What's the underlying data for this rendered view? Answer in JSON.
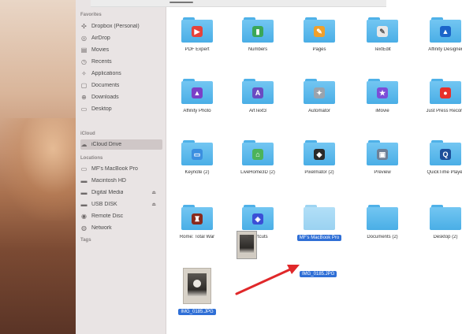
{
  "sidebar": {
    "sections": {
      "favorites": "Favorites",
      "cloud": "iCloud",
      "locations": "Locations",
      "tags": "Tags"
    },
    "favorites": [
      {
        "label": "Dropbox (Personal)",
        "icon": "dropbox-icon"
      },
      {
        "label": "AirDrop",
        "icon": "airdrop-icon"
      },
      {
        "label": "Movies",
        "icon": "movies-icon"
      },
      {
        "label": "Recents",
        "icon": "recents-icon"
      },
      {
        "label": "Applications",
        "icon": "applications-icon"
      },
      {
        "label": "Documents",
        "icon": "documents-icon"
      },
      {
        "label": "Downloads",
        "icon": "downloads-icon"
      },
      {
        "label": "Desktop",
        "icon": "desktop-icon"
      }
    ],
    "cloud": [
      {
        "label": "iCloud Drive",
        "icon": "icloud-icon",
        "selected": true
      }
    ],
    "locations": [
      {
        "label": "MF's MacBook Pro",
        "icon": "laptop-icon"
      },
      {
        "label": "Macintosh HD",
        "icon": "disk-icon"
      },
      {
        "label": "Digital Media",
        "icon": "disk-icon",
        "eject": "⏏"
      },
      {
        "label": "USB DISK",
        "icon": "disk-icon",
        "eject": "⏏"
      },
      {
        "label": "Remote Disc",
        "icon": "disc-icon"
      },
      {
        "label": "Network",
        "icon": "network-icon"
      }
    ]
  },
  "files": [
    {
      "label": "PDF Expert",
      "badge_color": "#e5423a",
      "badge_icon": "pdf-expert-icon",
      "glyph": "▶"
    },
    {
      "label": "Numbers",
      "badge_color": "#3aa757",
      "badge_icon": "numbers-icon",
      "glyph": "▮"
    },
    {
      "label": "Pages",
      "badge_color": "#f0a02a",
      "badge_icon": "pages-icon",
      "glyph": "✎"
    },
    {
      "label": "TextEdit",
      "badge_color": "#e8e8e8",
      "badge_icon": "textedit-icon",
      "glyph": "✎"
    },
    {
      "label": "Affinity Designer",
      "badge_color": "#1b64c9",
      "badge_icon": "affinity-designer-icon",
      "glyph": "▲"
    },
    {
      "label": "Affinity Photo",
      "badge_color": "#7b3fc7",
      "badge_icon": "affinity-photo-icon",
      "glyph": "▲"
    },
    {
      "label": "ArtText3",
      "badge_color": "#6a4bc2",
      "badge_icon": "arttext-icon",
      "glyph": "A"
    },
    {
      "label": "Automator",
      "badge_color": "#9aa3ad",
      "badge_icon": "automator-icon",
      "glyph": "✦"
    },
    {
      "label": "iMovie",
      "badge_color": "#7c4dd8",
      "badge_icon": "imovie-icon",
      "glyph": "★"
    },
    {
      "label": "Just Press Record",
      "badge_color": "#e7302a",
      "badge_icon": "record-icon",
      "glyph": "●"
    },
    {
      "label": "Keynote (2)",
      "badge_color": "#3b8fe0",
      "badge_icon": "keynote-icon",
      "glyph": "▭"
    },
    {
      "label": "LiveHome3D (2)",
      "badge_color": "#4cb35a",
      "badge_icon": "livehome3d-icon",
      "glyph": "⌂"
    },
    {
      "label": "Pixelmator (2)",
      "badge_color": "#2a2a2a",
      "badge_icon": "pixelmator-icon",
      "glyph": "◆"
    },
    {
      "label": "Preview",
      "badge_color": "#6e7f96",
      "badge_icon": "preview-icon",
      "glyph": "▣"
    },
    {
      "label": "QuickTime Player",
      "badge_color": "#1d4f9a",
      "badge_icon": "quicktime-icon",
      "glyph": "Q"
    },
    {
      "label": "Rome: Total War",
      "badge_color": "#8a2a1c",
      "badge_icon": "rome-total-war-icon",
      "glyph": "♜"
    },
    {
      "label": "Shortcuts",
      "badge_color": "#3b4fd6",
      "badge_icon": "shortcuts-icon",
      "glyph": "◈"
    },
    {
      "label": "MF's MacBook Pro",
      "badge_color": "",
      "badge_icon": "",
      "glyph": "",
      "selected": true
    },
    {
      "label": "Documents (2)",
      "badge_color": "",
      "badge_icon": "",
      "glyph": ""
    },
    {
      "label": "Desktop (2)",
      "badge_color": "",
      "badge_icon": "",
      "glyph": ""
    }
  ],
  "photo_file": {
    "label": "IMG_0185.JPG"
  },
  "drag_label": "IMG_0185.JPG",
  "arrow_color": "#e0282a"
}
